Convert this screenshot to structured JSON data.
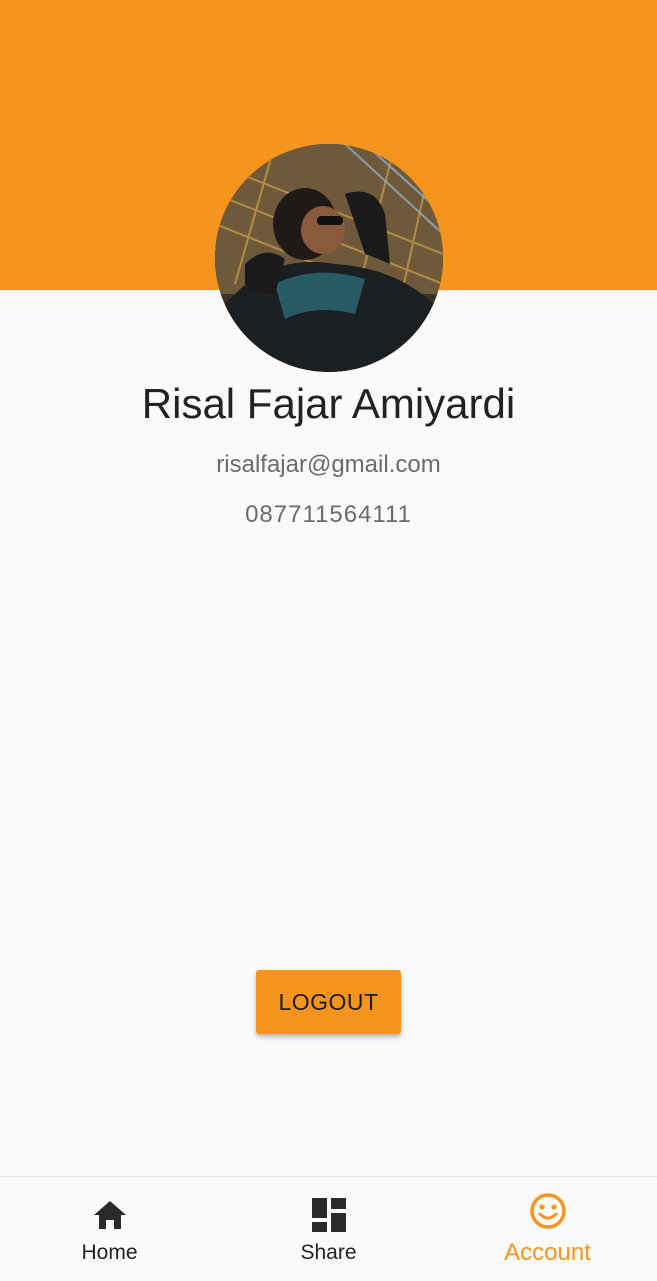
{
  "profile": {
    "name": "Risal Fajar Amiyardi",
    "email": "risalfajar@gmail.com",
    "phone": "087711564111",
    "avatar_icon": "profile-photo"
  },
  "actions": {
    "logout_label": "LOGOUT"
  },
  "bottom_nav": {
    "items": [
      {
        "label": "Home",
        "icon": "home-icon",
        "active": false
      },
      {
        "label": "Share",
        "icon": "dashboard-icon",
        "active": false
      },
      {
        "label": "Account",
        "icon": "smiley-icon",
        "active": true
      }
    ]
  },
  "colors": {
    "accent": "#f7941d",
    "background": "#fafafa",
    "text_primary": "#222222",
    "text_secondary": "#6b6b6b"
  }
}
